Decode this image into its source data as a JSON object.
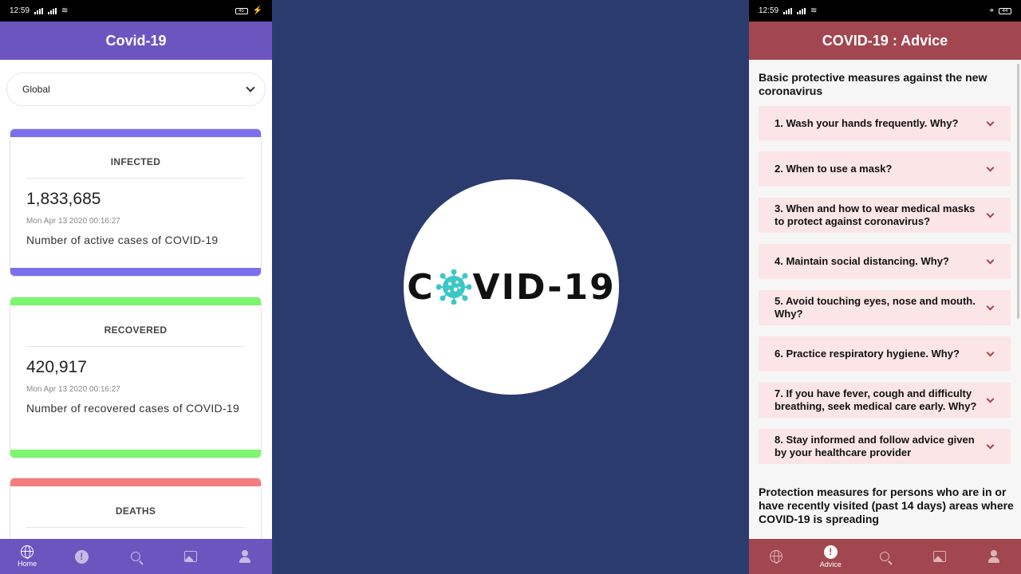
{
  "status": {
    "time": "12:59",
    "battery_left": "45",
    "battery_right": "44"
  },
  "left_app": {
    "title": "Covid-19",
    "region_select": "Global",
    "cards": [
      {
        "title": "INFECTED",
        "value": "1,833,685",
        "date": "Mon Apr 13 2020 00:16:27",
        "desc": "Number of active cases of COVID-19",
        "color": "#7b6ff0"
      },
      {
        "title": "RECOVERED",
        "value": "420,917",
        "date": "Mon Apr 13 2020 00:16:27",
        "desc": "Number of recovered cases of COVID-19",
        "color": "#7cf56f"
      },
      {
        "title": "DEATHS",
        "color": "#f47c7c"
      }
    ],
    "nav": [
      {
        "icon": "globe-icon",
        "label": "Home"
      },
      {
        "icon": "alert-icon",
        "label": ""
      },
      {
        "icon": "search-icon",
        "label": ""
      },
      {
        "icon": "image-icon",
        "label": ""
      },
      {
        "icon": "user-icon",
        "label": ""
      }
    ],
    "accent": "#6d55c0"
  },
  "splash": {
    "logo_left": "C",
    "logo_right": "VID-19",
    "virus_color": "#3cc7c7",
    "background": "#2c3b6e"
  },
  "right_app": {
    "title": "COVID-19 : Advice",
    "section1": "Basic protective measures against the new coronavirus",
    "items": [
      "1. Wash your hands frequently. Why?",
      "2. When to use a mask?",
      "3. When and how to wear medical masks to protect against coronavirus?",
      "4. Maintain social distancing. Why?",
      "5. Avoid touching eyes, nose and mouth. Why?",
      "6. Practice respiratory hygiene. Why?",
      "7. If you have fever, cough and difficulty breathing, seek medical care early. Why?",
      "8. Stay informed and follow advice given by your healthcare provider"
    ],
    "section2": "Protection measures for persons who are in or have recently visited (past 14 days) areas where COVID-19 is spreading",
    "nav_active_label": "Advice",
    "accent": "#a2464f"
  }
}
